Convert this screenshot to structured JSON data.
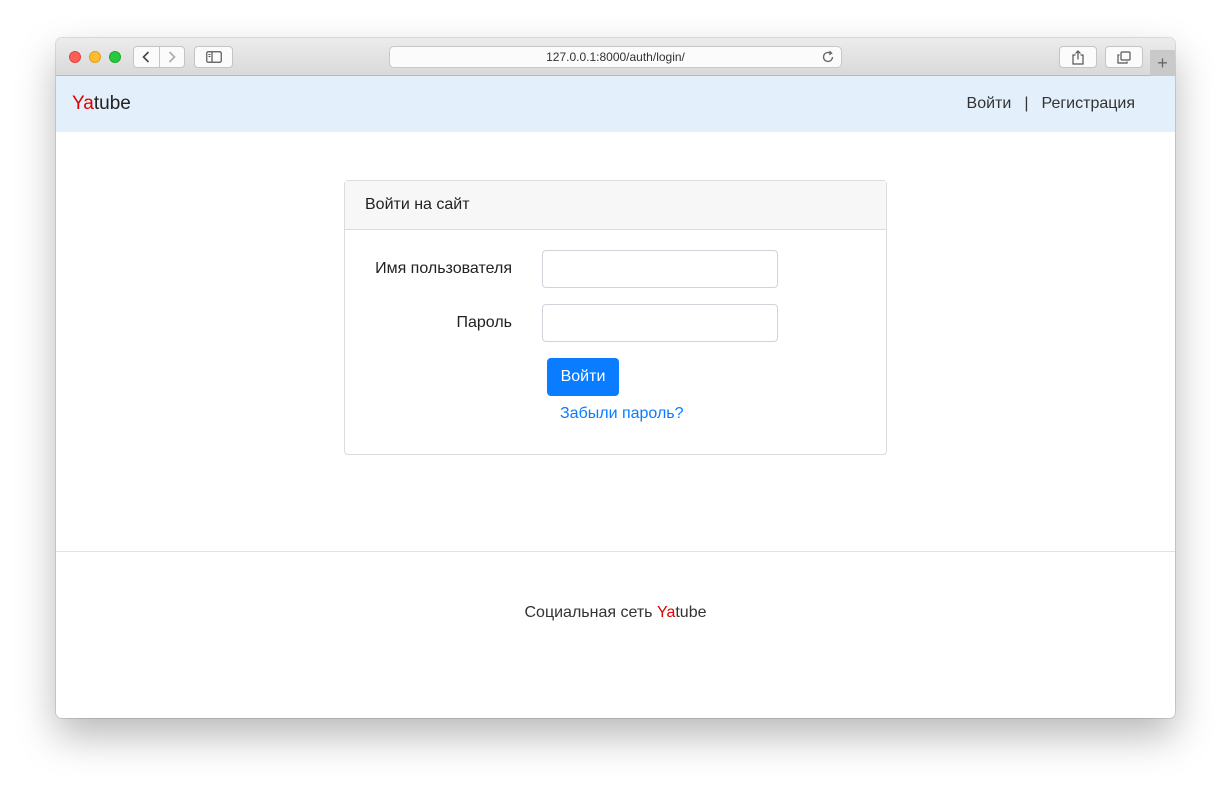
{
  "browser": {
    "url": "127.0.0.1:8000/auth/login/",
    "back_icon": "chevron-left-icon",
    "forward_icon": "chevron-right-icon",
    "new_tab_label": "+"
  },
  "navbar": {
    "brand_prefix": "Ya",
    "brand_suffix": "tube",
    "login_link": "Войти",
    "separator": "|",
    "register_link": "Регистрация",
    "background": "#e3f0fb"
  },
  "login_card": {
    "title": "Войти на сайт",
    "username_label": "Имя пользователя",
    "username_value": "",
    "password_label": "Пароль",
    "password_value": "",
    "submit_label": "Войти",
    "forgot_link": "Забыли пароль?"
  },
  "footer": {
    "text_prefix": "Социальная сеть ",
    "brand_prefix": "Ya",
    "brand_suffix": "tube"
  },
  "colors": {
    "accent": "#0a7cff",
    "brand_red": "#e00000"
  }
}
